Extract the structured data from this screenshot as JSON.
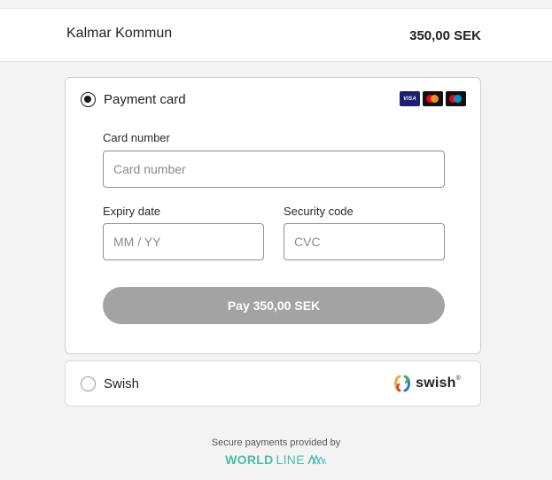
{
  "header": {
    "merchant": "Kalmar Kommun",
    "amount": "350,00 SEK"
  },
  "payment_card": {
    "label": "Payment card",
    "selected": true,
    "brands": [
      "VISA",
      "mastercard",
      "maestro"
    ],
    "card_number_label": "Card number",
    "card_number_placeholder": "Card number",
    "expiry_label": "Expiry date",
    "expiry_placeholder": "MM / YY",
    "security_label": "Security code",
    "security_placeholder": "CVC",
    "pay_button": "Pay 350,00 SEK"
  },
  "swish": {
    "label": "Swish",
    "selected": false,
    "logo_text": "swish",
    "logo_reg": "®"
  },
  "footer": {
    "provided_by": "Secure payments provided by",
    "brand_bold": "WORLD",
    "brand_light": "LINE"
  },
  "colors": {
    "pay_button": "#a3a3a3",
    "worldline": "#46beaa",
    "visa": "#1a1f71"
  }
}
